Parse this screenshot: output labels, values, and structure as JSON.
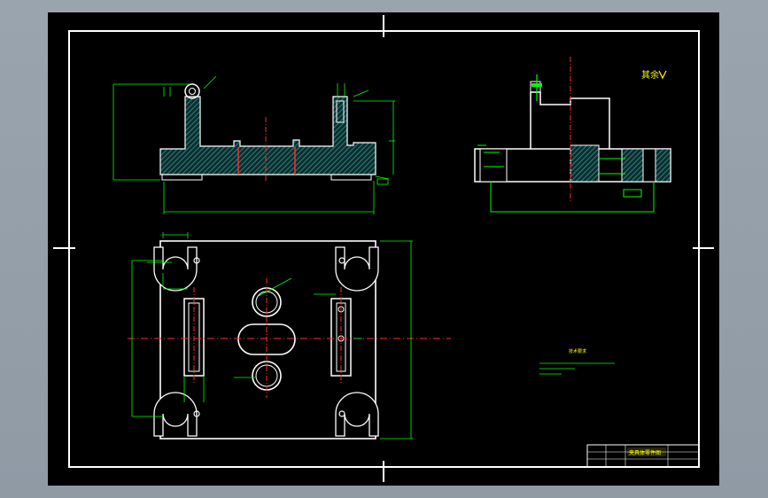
{
  "drawing": {
    "background": "#000000",
    "frame_color": "#ffffff",
    "section_color": "#2e8b8b",
    "dimension_color": "#00ff00",
    "centerline_color": "#ff2a2a",
    "accent_color": "#ffff00"
  },
  "views": {
    "front": {
      "label": "front-section-view"
    },
    "side": {
      "label": "side-section-view",
      "roughness_note": "其余"
    },
    "plan": {
      "label": "plan-view"
    }
  },
  "notes": {
    "heading": "技术要求",
    "lines": [
      "1. ",
      "2. ",
      "3. "
    ]
  },
  "title_block": {
    "title": "夹具体零件图",
    "code": ""
  }
}
